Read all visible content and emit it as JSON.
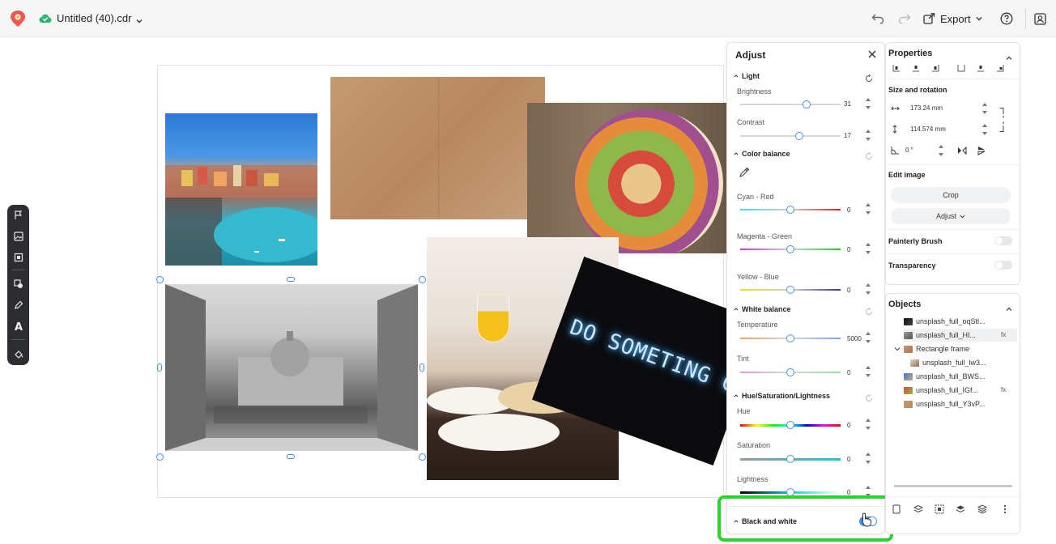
{
  "topbar": {
    "doc_title": "Untitled (40).cdr",
    "export_label": "Export",
    "icons": [
      "logo-icon",
      "cloud-check-icon",
      "undo-icon",
      "redo-icon",
      "export-icon",
      "help-icon",
      "profile-icon"
    ]
  },
  "canvas": {
    "neon_text": "DO SOMETING GREAT"
  },
  "left_toolbar": {
    "icons": [
      "flag-icon",
      "image-icon",
      "frame-icon",
      "shape-icon",
      "pen-icon",
      "text-icon",
      "fill-icon"
    ]
  },
  "adjust": {
    "title": "Adjust",
    "light": {
      "title": "Light",
      "brightness": {
        "label": "Brightness",
        "value": "31"
      },
      "contrast": {
        "label": "Contrast",
        "value": "17"
      }
    },
    "color_balance": {
      "title": "Color balance",
      "cyan_red": {
        "label": "Cyan - Red",
        "value": "0"
      },
      "magenta_green": {
        "label": "Magenta - Green",
        "value": "0"
      },
      "yellow_blue": {
        "label": "Yellow - Blue",
        "value": "0"
      }
    },
    "white_balance": {
      "title": "White balance",
      "temperature": {
        "label": "Temperature",
        "value": "5000"
      },
      "tint": {
        "label": "Tint",
        "value": "0"
      }
    },
    "hsl": {
      "title": "Hue/Saturation/Lightness",
      "hue": {
        "label": "Hue",
        "value": "0"
      },
      "saturation": {
        "label": "Saturation",
        "value": "0"
      },
      "lightness": {
        "label": "Lightness",
        "value": "0"
      }
    },
    "black_white": {
      "label": "Black and white",
      "enabled": true
    }
  },
  "properties": {
    "title": "Properties",
    "size_rotation": "Size and rotation",
    "width": "173.24 mm",
    "height": "114.574 mm",
    "rotation": "0 °",
    "edit_image": "Edit image",
    "crop": "Crop",
    "adjust": "Adjust",
    "painterly_brush": "Painterly Brush",
    "transparency": "Transparency"
  },
  "objects": {
    "title": "Objects",
    "items": [
      {
        "label": "unsplash_full_oqStl...",
        "indent": 0,
        "extra": ""
      },
      {
        "label": "unsplash_full_HI...",
        "indent": 0,
        "extra": "fx"
      },
      {
        "label": "Rectangle frame",
        "indent": -1,
        "extra": ""
      },
      {
        "label": "unsplash_full_lw3...",
        "indent": 1,
        "extra": ""
      },
      {
        "label": "unsplash_full_BWS...",
        "indent": 0,
        "extra": ""
      },
      {
        "label": "unsplash_full_IGf...",
        "indent": 0,
        "extra": "fx"
      },
      {
        "label": "unsplash_full_Y3vP...",
        "indent": 0,
        "extra": ""
      }
    ]
  },
  "colors": {
    "accent": "#3d8cf0",
    "highlight": "#2ad42a",
    "toolbar_bg": "#2b2d31"
  }
}
